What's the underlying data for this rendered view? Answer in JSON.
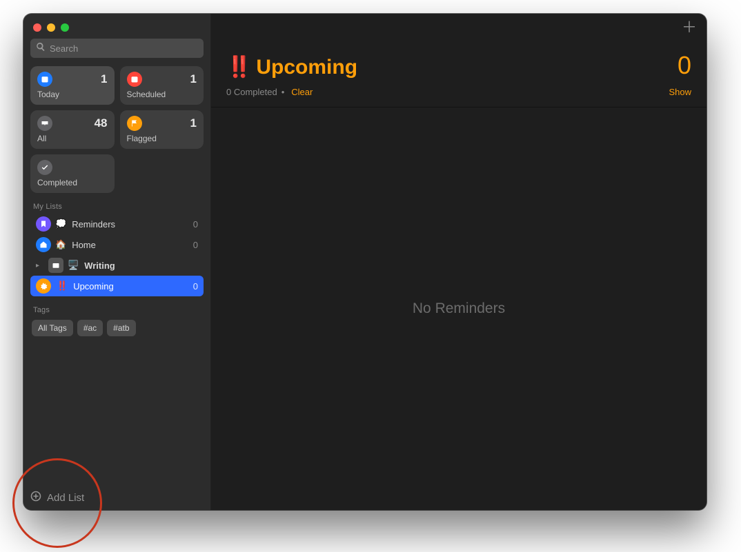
{
  "search": {
    "placeholder": "Search"
  },
  "smart": {
    "today": {
      "label": "Today",
      "count": "1"
    },
    "scheduled": {
      "label": "Scheduled",
      "count": "1"
    },
    "all": {
      "label": "All",
      "count": "48"
    },
    "flagged": {
      "label": "Flagged",
      "count": "1"
    },
    "completed": {
      "label": "Completed"
    }
  },
  "sidebar": {
    "mylists_header": "My Lists",
    "tags_header": "Tags",
    "items": [
      {
        "emoji": "💭",
        "label": "Reminders",
        "count": "0"
      },
      {
        "emoji": "🏠",
        "label": "Home",
        "count": "0"
      },
      {
        "emoji": "🖥️",
        "label": "Writing",
        "count": ""
      },
      {
        "bangs": "‼️",
        "label": "Upcoming",
        "count": "0"
      }
    ],
    "tags": [
      "All Tags",
      "#ac",
      "#atb"
    ]
  },
  "footer": {
    "add_list": "Add List"
  },
  "main": {
    "title_prefix": "‼️",
    "title": "Upcoming",
    "count": "0",
    "completed_text": "0 Completed",
    "dot": "•",
    "clear": "Clear",
    "show": "Show",
    "empty": "No Reminders"
  }
}
